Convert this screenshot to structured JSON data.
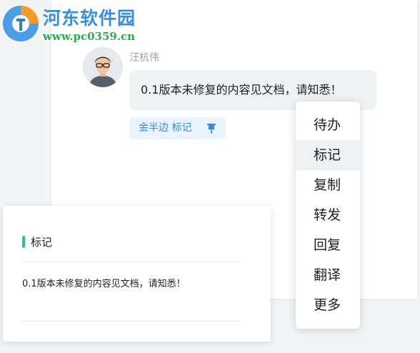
{
  "watermark": {
    "title": "河东软件园",
    "url": "www.pc0359.cn"
  },
  "message": {
    "sender_name": "汪杭伟",
    "text": "0.1版本未修复的内容见文档，请知悉！",
    "mark_tag_label": "金半边 标记"
  },
  "context_menu": {
    "items": [
      "待办",
      "标记",
      "复制",
      "转发",
      "回复",
      "翻译",
      "更多"
    ],
    "active_item": "标记"
  },
  "detail_panel": {
    "title": "标记",
    "content": "0.1版本未修复的内容见文档，请知悉！"
  },
  "colors": {
    "accent_blue": "#2f8ce0",
    "tag_background": "#eaf4fe",
    "panel_accent": "#20c997",
    "watermark_blue": "#3a8fdd",
    "watermark_green": "#2fa84f"
  },
  "icons": {
    "mark_tag": "pin-icon",
    "watermark_logo": "pc0359-logo"
  }
}
